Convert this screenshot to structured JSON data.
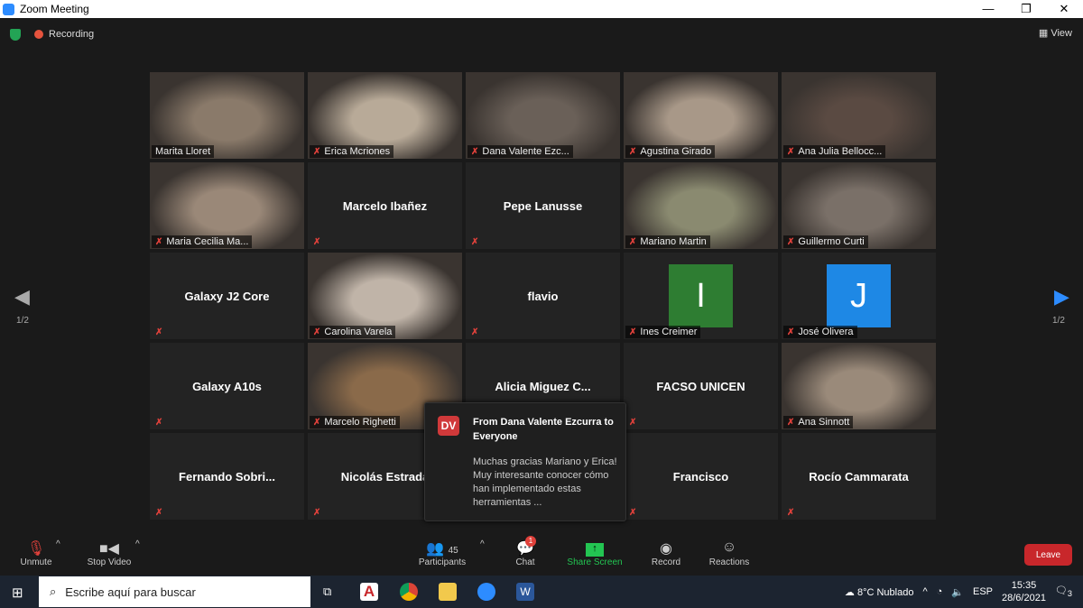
{
  "window": {
    "title": "Zoom Meeting",
    "controls": [
      "—",
      "❐",
      "✕"
    ]
  },
  "topbar": {
    "recording": "Recording",
    "view": "View"
  },
  "nav": {
    "page": "1/2",
    "prev_icon": "chevron-left-icon",
    "next_icon": "chevron-right-icon"
  },
  "tiles": [
    {
      "name": "Marita Lloret",
      "type": "video",
      "active": true,
      "muted": false,
      "color": "#8a7a6a"
    },
    {
      "name": "Erica Mcriones",
      "type": "video",
      "muted": true,
      "color": "#b8aa98"
    },
    {
      "name": "Dana Valente Ezc...",
      "type": "video",
      "muted": true,
      "color": "#6a6058"
    },
    {
      "name": "Agustina Girado",
      "type": "video",
      "muted": true,
      "color": "#a89888"
    },
    {
      "name": "Ana Julia Bellocc...",
      "type": "video",
      "muted": true,
      "color": "#5a4a42"
    },
    {
      "name": "Maria Cecilia Ma...",
      "type": "video",
      "muted": true,
      "color": "#9a8878"
    },
    {
      "name": "Marcelo Ibañez",
      "type": "name",
      "muted": true
    },
    {
      "name": "Pepe Lanusse",
      "type": "name",
      "muted": true
    },
    {
      "name": "Mariano Martin",
      "type": "video",
      "muted": true,
      "color": "#8a8a70"
    },
    {
      "name": "Guillermo Curti",
      "type": "video",
      "muted": true,
      "color": "#7a7068"
    },
    {
      "name": "Galaxy J2 Core",
      "type": "name",
      "muted": true
    },
    {
      "name": "Carolina Varela",
      "type": "video",
      "muted": true,
      "color": "#c0b4a8"
    },
    {
      "name": "flavio",
      "type": "name",
      "muted": true
    },
    {
      "name": "Ines Creimer",
      "type": "avatar",
      "letter": "I",
      "color": "#2e7d32",
      "muted": true
    },
    {
      "name": "José Olivera",
      "type": "avatar",
      "letter": "J",
      "color": "#1e88e5",
      "muted": true
    },
    {
      "name": "Galaxy A10s",
      "type": "name",
      "muted": true
    },
    {
      "name": "Marcelo Righetti",
      "type": "video",
      "muted": true,
      "color": "#8a6a4a"
    },
    {
      "name": "Alicia Miguez C...",
      "type": "name",
      "muted": true
    },
    {
      "name": "FACSO UNICEN",
      "type": "name",
      "muted": true
    },
    {
      "name": "Ana Sinnott",
      "type": "video",
      "muted": true,
      "color": "#9a8a7a"
    },
    {
      "name": "Fernando  Sobri...",
      "type": "name",
      "muted": true
    },
    {
      "name": "Nicolás Estrada",
      "type": "name",
      "muted": true
    },
    {
      "name": "",
      "type": "name",
      "muted": true
    },
    {
      "name": "Francisco",
      "type": "name",
      "muted": true
    },
    {
      "name": "Rocío Cammarata",
      "type": "name",
      "muted": true
    }
  ],
  "chat_popup": {
    "initials": "DV",
    "from": "From Dana Valente Ezcurra to Everyone",
    "message": "Muchas gracias Mariano y Erica! Muy interesante conocer cómo han implementado estas herramientas ..."
  },
  "toolbar": {
    "unmute": "Unmute",
    "stop_video": "Stop Video",
    "participants": "Participants",
    "participants_count": "45",
    "chat": "Chat",
    "chat_badge": "1",
    "share_screen": "Share Screen",
    "record": "Record",
    "reactions": "Reactions",
    "leave": "Leave",
    "share_color": "#23c552"
  },
  "taskbar": {
    "search_placeholder": "Escribe aquí para buscar",
    "weather": "8°C  Nublado",
    "lang": "ESP",
    "time": "15:35",
    "date": "28/6/2021",
    "notifications": "3"
  }
}
